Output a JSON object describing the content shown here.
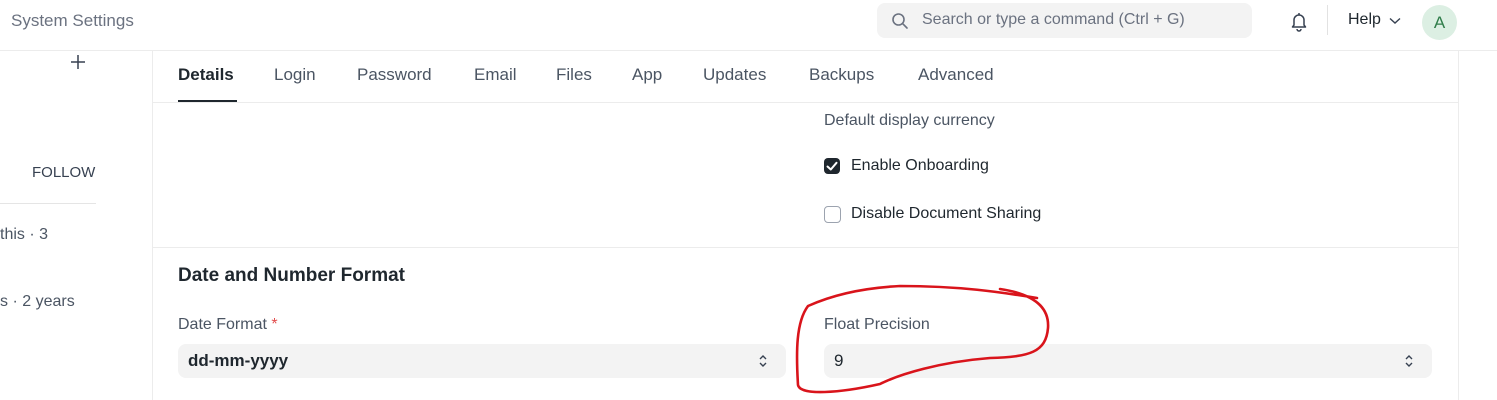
{
  "navbar": {
    "title": "System Settings",
    "search_placeholder": "Search or type a command (Ctrl + G)",
    "help_label": "Help",
    "avatar_initial": "A"
  },
  "sidebar": {
    "follow_label": "FOLLOW",
    "activity": [
      "this · 3",
      "s · 2 years"
    ]
  },
  "tabs": [
    "Details",
    "Login",
    "Password",
    "Email",
    "Files",
    "App",
    "Updates",
    "Backups",
    "Advanced"
  ],
  "active_tab": "Details",
  "fields": {
    "default_currency_label": "Default display currency",
    "enable_onboarding": {
      "label": "Enable Onboarding",
      "checked": true
    },
    "disable_document_sharing": {
      "label": "Disable Document Sharing",
      "checked": false
    }
  },
  "section": {
    "title": "Date and Number Format",
    "date_format": {
      "label": "Date Format",
      "required_marker": "*",
      "value": "dd-mm-yyyy"
    },
    "float_precision": {
      "label": "Float Precision",
      "value": "9"
    }
  },
  "annotation": {
    "color": "#d9141b"
  }
}
